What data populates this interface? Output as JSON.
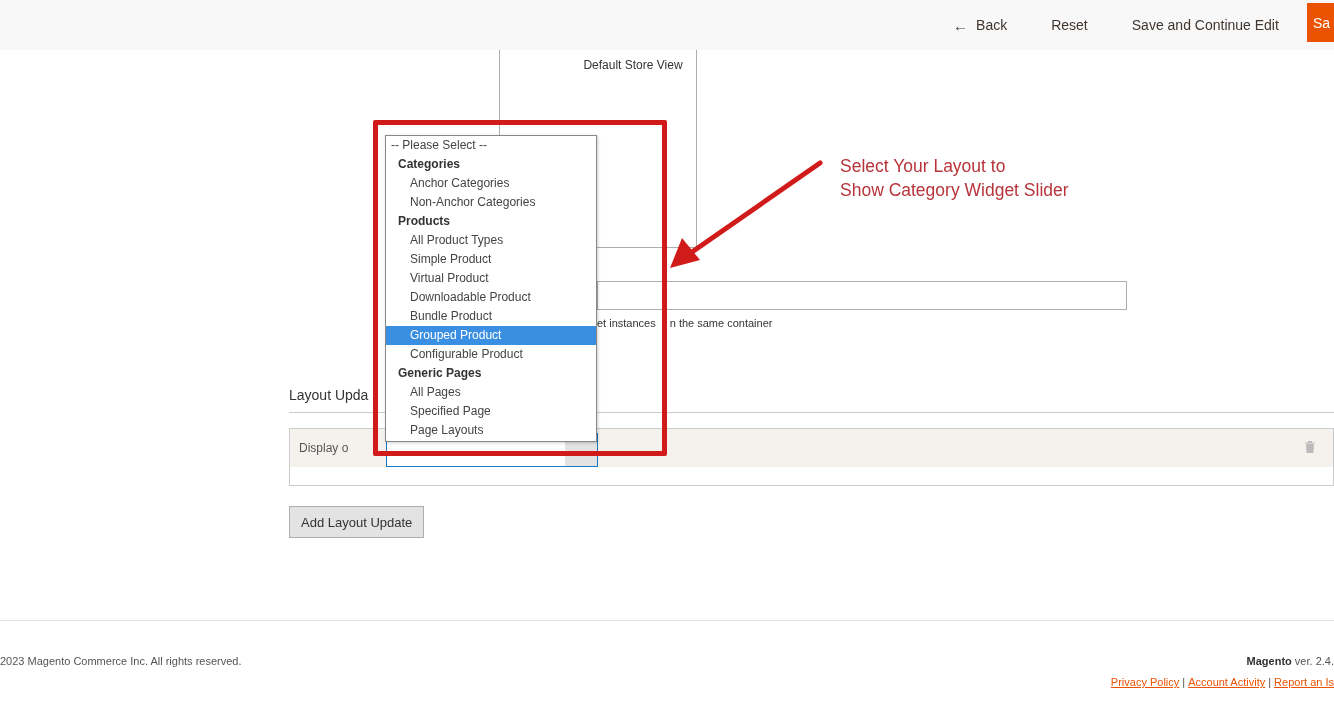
{
  "header": {
    "buttons": [
      {
        "label": "Back",
        "icon": "←",
        "kind": "back"
      },
      {
        "label": "Reset",
        "kind": "link"
      },
      {
        "label": "Save and Continue Edit",
        "kind": "link"
      },
      {
        "label": "Sa",
        "kind": "primary"
      }
    ]
  },
  "store_views": {
    "options": [
      "Default Store View"
    ]
  },
  "container_field": {
    "note_parts": [
      "et instances",
      "n the same container"
    ]
  },
  "layout_updates": {
    "title": "Layout Upda",
    "rows": [
      {
        "label": "Display o"
      }
    ],
    "add_button": "Add Layout Update"
  },
  "dropdown": {
    "options": [
      {
        "label": "-- Please Select --",
        "kind": "option",
        "selected": false
      },
      {
        "label": "Categories",
        "kind": "group"
      },
      {
        "label": "Anchor Categories",
        "kind": "option",
        "selected": false
      },
      {
        "label": "Non-Anchor Categories",
        "kind": "option",
        "selected": false
      },
      {
        "label": "Products",
        "kind": "group"
      },
      {
        "label": "All Product Types",
        "kind": "option",
        "selected": false
      },
      {
        "label": "Simple Product",
        "kind": "option",
        "selected": false
      },
      {
        "label": "Virtual Product",
        "kind": "option",
        "selected": false
      },
      {
        "label": "Downloadable Product",
        "kind": "option",
        "selected": false
      },
      {
        "label": "Bundle Product",
        "kind": "option",
        "selected": false
      },
      {
        "label": "Grouped Product",
        "kind": "option",
        "selected": true
      },
      {
        "label": "Configurable Product",
        "kind": "option",
        "selected": false
      },
      {
        "label": "Generic Pages",
        "kind": "group"
      },
      {
        "label": "All Pages",
        "kind": "option",
        "selected": false
      },
      {
        "label": "Specified Page",
        "kind": "option",
        "selected": false
      },
      {
        "label": "Page Layouts",
        "kind": "option",
        "selected": false
      }
    ]
  },
  "annotation": {
    "lines": [
      "Select Your Layout to",
      "Show Category Widget Slider"
    ]
  },
  "footer": {
    "copyright": "2023 Magento Commerce Inc. All rights reserved.",
    "version_brand": "Magento",
    "version": "ver. 2.4.",
    "links": [
      "Privacy Policy",
      "Account Activity",
      "Report an Is"
    ],
    "separator": "|"
  }
}
